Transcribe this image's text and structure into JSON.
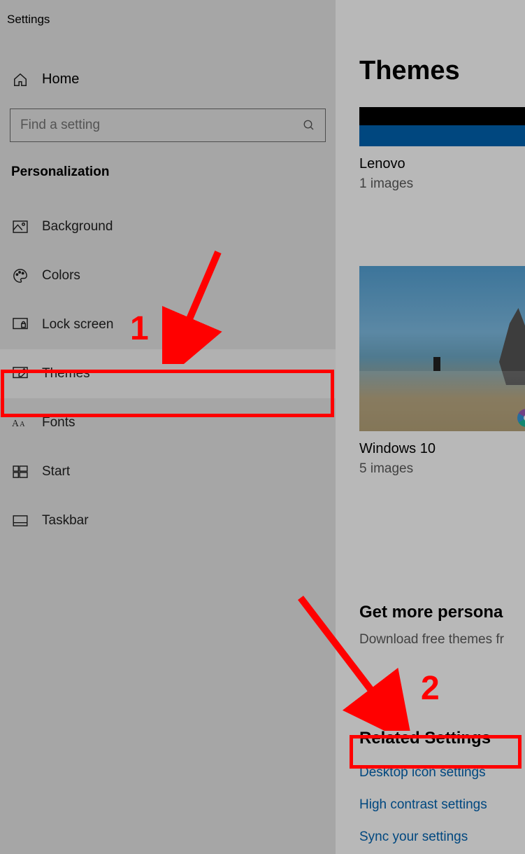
{
  "window": {
    "title": "Settings"
  },
  "sidebar": {
    "home": "Home",
    "search_placeholder": "Find a setting",
    "section": "Personalization",
    "items": [
      {
        "label": "Background",
        "icon": "image-icon"
      },
      {
        "label": "Colors",
        "icon": "palette-icon"
      },
      {
        "label": "Lock screen",
        "icon": "lockscreen-icon"
      },
      {
        "label": "Themes",
        "icon": "themes-icon",
        "active": true
      },
      {
        "label": "Fonts",
        "icon": "fonts-icon"
      },
      {
        "label": "Start",
        "icon": "start-icon"
      },
      {
        "label": "Taskbar",
        "icon": "taskbar-icon"
      }
    ]
  },
  "content": {
    "title": "Themes",
    "themes": [
      {
        "name": "Lenovo",
        "sub": "1 images"
      },
      {
        "name": "Windows 10",
        "sub": "5 images"
      }
    ],
    "more": {
      "title": "Get more persona",
      "sub": "Download free themes fr"
    },
    "related": {
      "title": "Related Settings",
      "links": [
        "Desktop icon settings",
        "High contrast settings",
        "Sync your settings"
      ]
    }
  },
  "annotations": {
    "step1": "1",
    "step2": "2"
  }
}
